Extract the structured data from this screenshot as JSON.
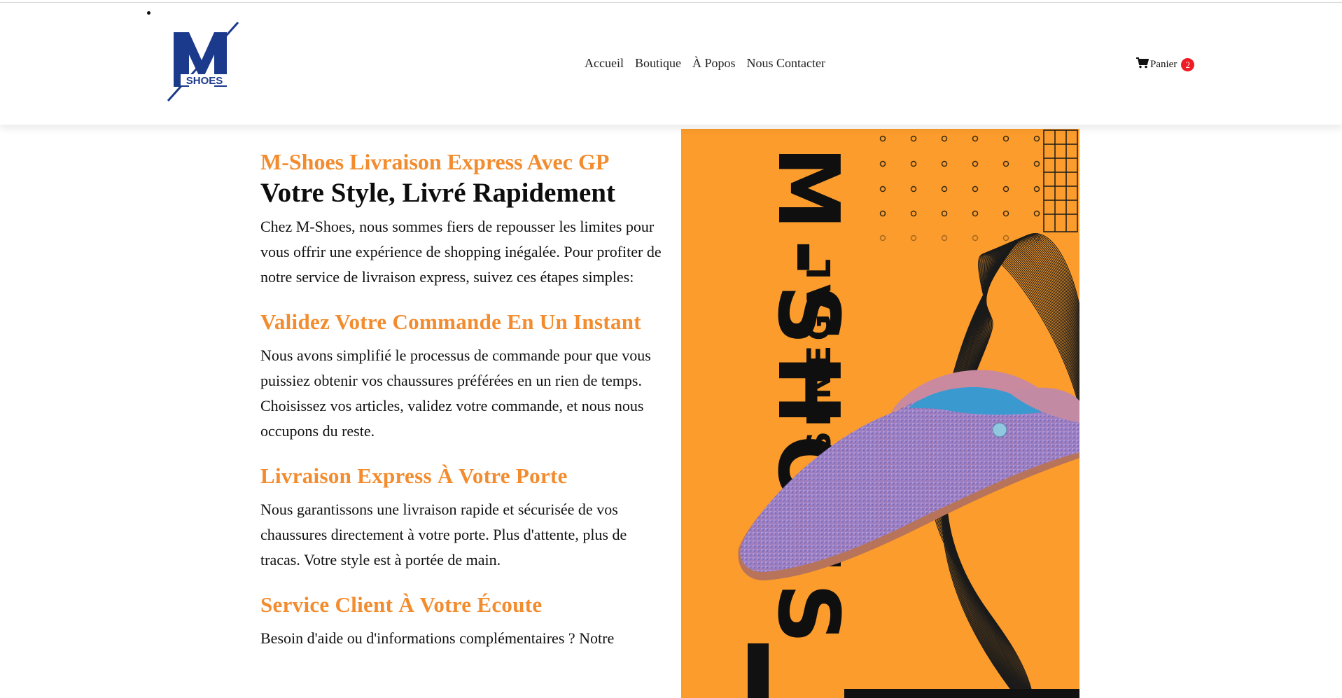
{
  "header": {
    "logo_text": "SHOES",
    "nav": [
      {
        "label": "Accueil"
      },
      {
        "label": "Boutique"
      },
      {
        "label": "À Popos"
      },
      {
        "label": "Nous Contacter"
      }
    ],
    "cart": {
      "label": "Panier",
      "count": "2"
    }
  },
  "main": {
    "subtitle": "M-Shoes Livraison Express Avec GP",
    "title": "Votre Style, Livré Rapidement",
    "intro": "Chez M-Shoes, nous sommes fiers de repousser les limites pour vous offrir une expérience de shopping inégalée. Pour profiter de notre service de livraison express, suivez ces étapes simples:",
    "sections": [
      {
        "heading": "Validez Votre Commande En Un Instant",
        "text": "Nous avons simplifié le processus de commande pour que vous puissiez obtenir vos chaussures préférées en un rien de temps. Choisissez vos articles, validez votre commande, et nous nous occupons du reste."
      },
      {
        "heading": "Livraison Express À Votre Porte",
        "text": "Nous garantissons une livraison rapide et sécurisée de vos chaussures directement à votre porte. Plus d'attente, plus de tracas. Votre style est à portée de main."
      },
      {
        "heading": "Service Client À Votre Écoute",
        "text": "Besoin d'aide ou d'informations complémentaires ? Notre"
      }
    ]
  },
  "poster": {
    "brand_text": "M-SHOES",
    "country_text": "SENEGAL"
  },
  "colors": {
    "accent": "#f28c2e",
    "poster_bg": "#fb9c2c",
    "logo_blue": "#1c3a8c",
    "badge_red": "#ee1c25"
  }
}
